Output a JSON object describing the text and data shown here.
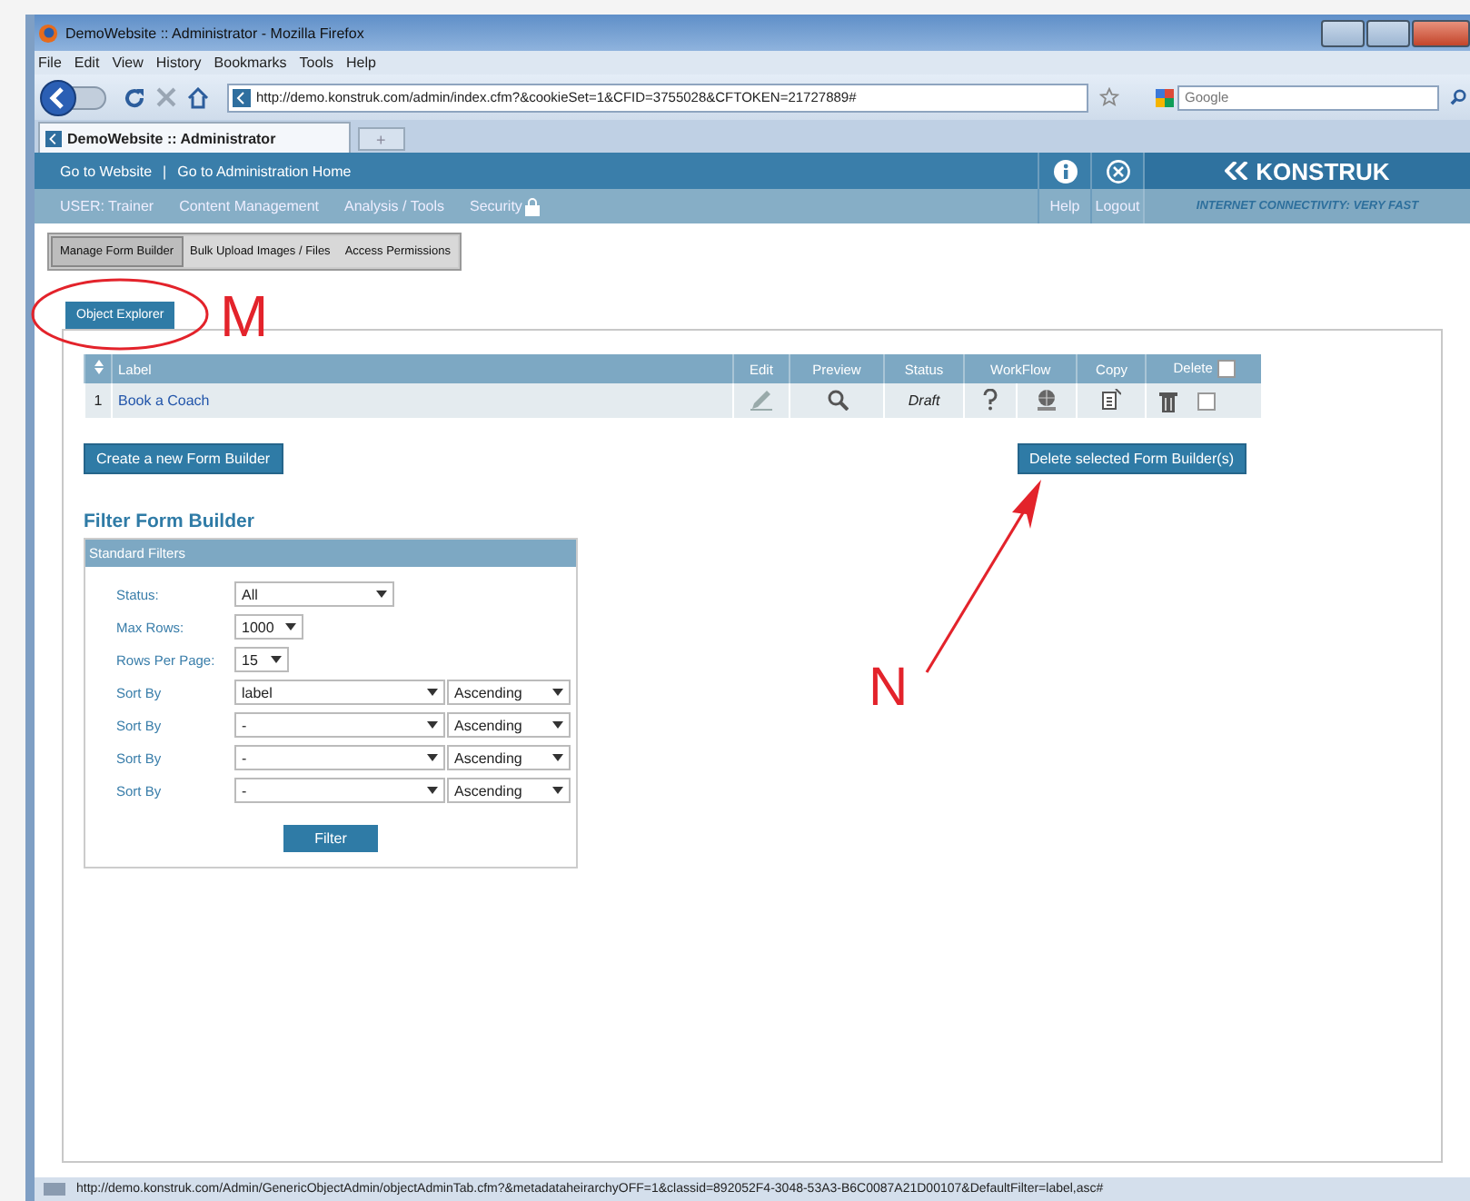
{
  "browser": {
    "title": "DemoWebsite :: Administrator - Mozilla Firefox",
    "menu": [
      "File",
      "Edit",
      "View",
      "History",
      "Bookmarks",
      "Tools",
      "Help"
    ],
    "url": "http://demo.konstruk.com/admin/index.cfm?&cookieSet=1&CFID=3755028&CFTOKEN=21727889#",
    "search_placeholder": "Google",
    "tabs": [
      {
        "label": "DemoWebsite :: Administrator",
        "selected": true
      }
    ],
    "new_tab": "+",
    "status_url": "http://demo.konstruk.com/Admin/GenericObjectAdmin/objectAdminTab.cfm?&metadataheirarchyOFF=1&classid=892052F4-3048-53A3-B6C0087A21D00107&DefaultFilter=label,asc#"
  },
  "site": {
    "top_links": [
      "Go to Website",
      "Go to Administration Home"
    ],
    "separator": "|",
    "logo": "KONSTRUK",
    "nav": [
      "USER: Trainer",
      "Content Management",
      "Analysis / Tools",
      "Security"
    ],
    "help": "Help",
    "logout": "Logout",
    "connectivity": "INTERNET CONNECTIVITY: VERY FAST"
  },
  "subtabs": [
    {
      "label": "Manage Form Builder",
      "selected": true
    },
    {
      "label": "Bulk Upload Images / Files",
      "selected": false
    },
    {
      "label": "Access Permissions",
      "selected": false
    }
  ],
  "object_tab": "Object Explorer",
  "table": {
    "columns": [
      "Label",
      "Edit",
      "Preview",
      "Status",
      "WorkFlow",
      "Copy",
      "Delete"
    ],
    "select_all_checked": false,
    "rows": [
      {
        "index": "1",
        "label": "Book a Coach",
        "status": "Draft",
        "checked": false
      }
    ]
  },
  "create_button": "Create a new Form Builder",
  "delete_button": "Delete selected Form Builder(s)",
  "filter": {
    "title": "Filter Form Builder",
    "box_title": "Standard Filters",
    "button": "Filter",
    "rows": [
      {
        "kind": "select",
        "label": "Status:",
        "value": "All"
      },
      {
        "kind": "select",
        "label": "Max Rows:",
        "value": "1000"
      },
      {
        "kind": "select",
        "label": "Rows Per Page:",
        "value": "15"
      },
      {
        "kind": "sort",
        "label": "Sort By",
        "value": "label",
        "order": "Ascending"
      },
      {
        "kind": "sort",
        "label": "Sort By",
        "value": "-",
        "order": "Ascending"
      },
      {
        "kind": "sort",
        "label": "Sort By",
        "value": "-",
        "order": "Ascending"
      },
      {
        "kind": "sort",
        "label": "Sort By",
        "value": "-",
        "order": "Ascending"
      }
    ]
  },
  "annotations": [
    {
      "kind": "circle",
      "letter": "M"
    },
    {
      "kind": "arrow",
      "letter": "N"
    }
  ]
}
